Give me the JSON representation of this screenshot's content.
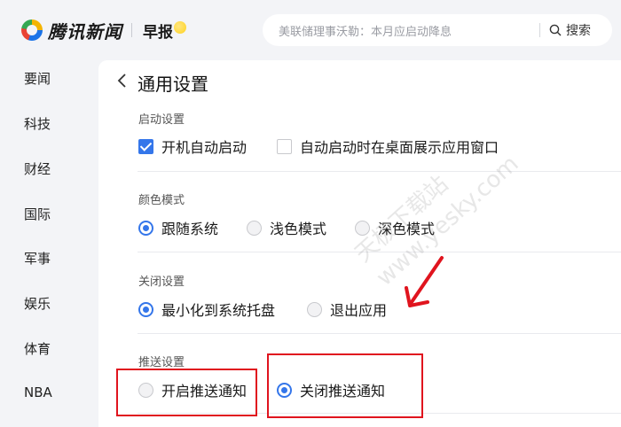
{
  "header": {
    "brand": "腾讯新闻",
    "morning": "早报",
    "search_placeholder": "美联储理事沃勒：本月应启动降息",
    "search_button": "搜索"
  },
  "sidebar": {
    "items": [
      {
        "label": "要闻"
      },
      {
        "label": "科技"
      },
      {
        "label": "财经"
      },
      {
        "label": "国际"
      },
      {
        "label": "军事"
      },
      {
        "label": "娱乐"
      },
      {
        "label": "体育"
      },
      {
        "label": "NBA"
      }
    ]
  },
  "settings": {
    "title": "通用设置",
    "startup": {
      "label": "启动设置",
      "options": [
        {
          "label": "开机自动启动",
          "checked": true
        },
        {
          "label": "自动启动时在桌面展示应用窗口",
          "checked": false
        }
      ]
    },
    "color": {
      "label": "颜色模式",
      "options": [
        {
          "label": "跟随系统",
          "selected": true
        },
        {
          "label": "浅色模式",
          "selected": false
        },
        {
          "label": "深色模式",
          "selected": false
        }
      ]
    },
    "close": {
      "label": "关闭设置",
      "options": [
        {
          "label": "最小化到系统托盘",
          "selected": true
        },
        {
          "label": "退出应用",
          "selected": false
        }
      ]
    },
    "push": {
      "label": "推送设置",
      "options": [
        {
          "label": "开启推送通知",
          "selected": false
        },
        {
          "label": "关闭推送通知",
          "selected": true
        }
      ]
    }
  },
  "watermark": {
    "line1": "天极下载站",
    "line2": "www.yesky.com"
  },
  "colors": {
    "accent": "#3476ea",
    "annotation": "#e0141e"
  }
}
